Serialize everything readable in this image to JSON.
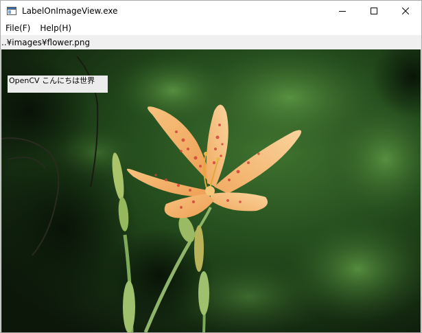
{
  "window": {
    "title": "LabelOnImageView.exe",
    "icon": "app-window-icon",
    "controls": [
      "minimize-icon",
      "maximize-icon",
      "close-icon"
    ]
  },
  "menu": {
    "items": [
      {
        "label": "File(F)"
      },
      {
        "label": "Help(H)"
      }
    ]
  },
  "path": {
    "text": "..¥images¥flower.png"
  },
  "image": {
    "overlay_label": "OpenCV こんにちは世界"
  },
  "colors": {
    "petal": "#f2b46a",
    "petal_light": "#f8cf96",
    "spots": "#d0453a",
    "foliage_dark": "#0e1a0c",
    "foliage_light": "#4f8a3a",
    "stem": "#8fb56a"
  }
}
